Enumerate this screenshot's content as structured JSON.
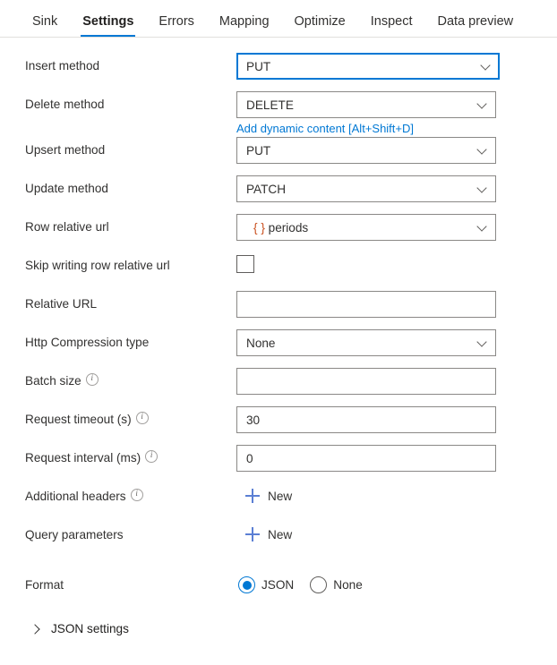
{
  "tabs": [
    {
      "label": "Sink",
      "active": false
    },
    {
      "label": "Settings",
      "active": true
    },
    {
      "label": "Errors",
      "active": false
    },
    {
      "label": "Mapping",
      "active": false
    },
    {
      "label": "Optimize",
      "active": false
    },
    {
      "label": "Inspect",
      "active": false
    },
    {
      "label": "Data preview",
      "active": false
    }
  ],
  "fields": {
    "insert_method": {
      "label": "Insert method",
      "value": "PUT"
    },
    "delete_method": {
      "label": "Delete method",
      "value": "DELETE"
    },
    "dynamic_content_link": "Add dynamic content [Alt+Shift+D]",
    "upsert_method": {
      "label": "Upsert method",
      "value": "PUT"
    },
    "update_method": {
      "label": "Update method",
      "value": "PATCH"
    },
    "row_relative_url": {
      "label": "Row relative url",
      "token": "{ }",
      "value": "periods"
    },
    "skip_writing_row_relative_url": {
      "label": "Skip writing row relative url",
      "checked": false
    },
    "relative_url": {
      "label": "Relative URL",
      "value": "",
      "placeholder": ""
    },
    "http_compression_type": {
      "label": "Http Compression type",
      "value": "None"
    },
    "batch_size": {
      "label": "Batch size",
      "value": "",
      "placeholder": ""
    },
    "request_timeout": {
      "label": "Request timeout (s)",
      "value": "30"
    },
    "request_interval": {
      "label": "Request interval (ms)",
      "value": "0"
    },
    "additional_headers": {
      "label": "Additional headers",
      "new_label": "New"
    },
    "query_parameters": {
      "label": "Query parameters",
      "new_label": "New"
    },
    "format": {
      "label": "Format",
      "options": [
        {
          "label": "JSON",
          "selected": true
        },
        {
          "label": "None",
          "selected": false
        }
      ]
    },
    "json_settings": {
      "label": "JSON settings",
      "expanded": false
    }
  },
  "icons": {
    "info": "info-icon",
    "chevron_down": "chevron-down-icon",
    "chevron_right": "chevron-right-icon",
    "plus": "plus-icon"
  },
  "colors": {
    "accent": "#0078d4",
    "link": "#0078d4",
    "token": "#c94f1d",
    "border": "#8a8886",
    "text": "#323130"
  }
}
